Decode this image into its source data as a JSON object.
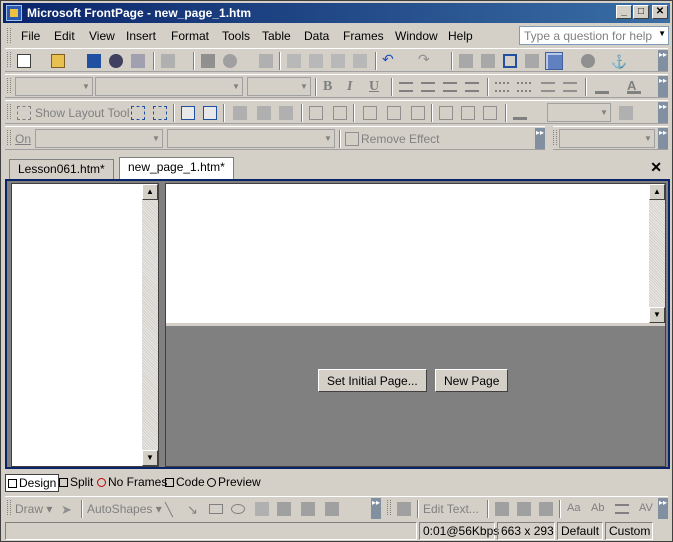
{
  "window": {
    "title": "Microsoft FrontPage - new_page_1.htm",
    "minimize": "_",
    "maximize": "□",
    "close": "✕"
  },
  "menu": {
    "items": [
      "File",
      "Edit",
      "View",
      "Insert",
      "Format",
      "Tools",
      "Table",
      "Data",
      "Frames",
      "Window",
      "Help"
    ],
    "help_placeholder": "Type a question for help"
  },
  "toolbars": {
    "show_layout_tool": "Show Layout Tool",
    "on_label": "On",
    "remove_effect": "Remove Effect",
    "bold": "B",
    "italic": "I",
    "underline": "U"
  },
  "tabs": {
    "items": [
      "Lesson061.htm*",
      "new_page_1.htm*"
    ],
    "active": "new_page_1.htm*",
    "close": "✕"
  },
  "content": {
    "set_initial_page": "Set Initial Page...",
    "new_page": "New Page"
  },
  "view_tabs": [
    "Design",
    "Split",
    "No Frames",
    "Code",
    "Preview"
  ],
  "draw_toolbar": {
    "draw": "Draw",
    "autoshapes": "AutoShapes",
    "edit_text": "Edit Text..."
  },
  "status": {
    "download": "0:01@56Kbps",
    "size": "663 x 293",
    "mode": "Default",
    "custom": "Custom"
  }
}
